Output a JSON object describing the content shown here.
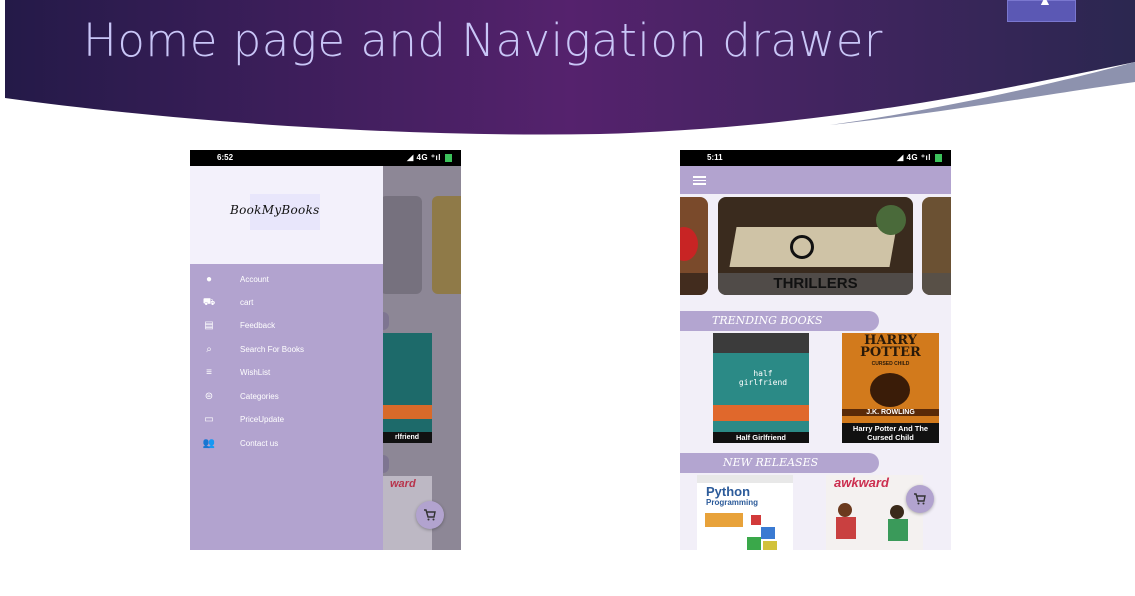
{
  "slide": {
    "title": "Home page and Navigation drawer"
  },
  "left_phone": {
    "status": {
      "time": "6:52",
      "signal": "4G"
    },
    "drawer": {
      "logo": "BookMyBooks",
      "items": [
        {
          "label": "Account",
          "icon": "account-icon"
        },
        {
          "label": "cart",
          "icon": "cart-icon"
        },
        {
          "label": "Feedback",
          "icon": "feedback-icon"
        },
        {
          "label": "Search For Books",
          "icon": "search-icon"
        },
        {
          "label": "WishList",
          "icon": "wishlist-icon"
        },
        {
          "label": "Categories",
          "icon": "categories-icon"
        },
        {
          "label": "PriceUpdate",
          "icon": "price-update-icon"
        },
        {
          "label": "Contact us",
          "icon": "contact-icon"
        }
      ]
    },
    "background_book_caption": "rlfriend"
  },
  "right_phone": {
    "status": {
      "time": "5:11",
      "signal": "4G"
    },
    "category": "THRILLERS",
    "sections": {
      "trending": "TRENDING BOOKS",
      "new_releases": "NEW RELEASES"
    },
    "trending_books": [
      {
        "title": "Half Girlfriend"
      },
      {
        "title": "Harry Potter And The Cursed Child"
      }
    ],
    "covers": {
      "half_girlfriend_cover": "half girlfriend",
      "hp_cover_line1": "HARRY",
      "hp_cover_line2": "POTTER",
      "hp_cover_line3": "CURSED CHILD",
      "hp_author": "J.K. ROWLING",
      "python_cover_line1": "Python",
      "python_cover_line2": "Programming",
      "awkward_cover": "awkward"
    }
  },
  "colors": {
    "drawer": "#b2a3cf",
    "toolbar": "#b2a3cf",
    "title": "#c9c6f7"
  }
}
